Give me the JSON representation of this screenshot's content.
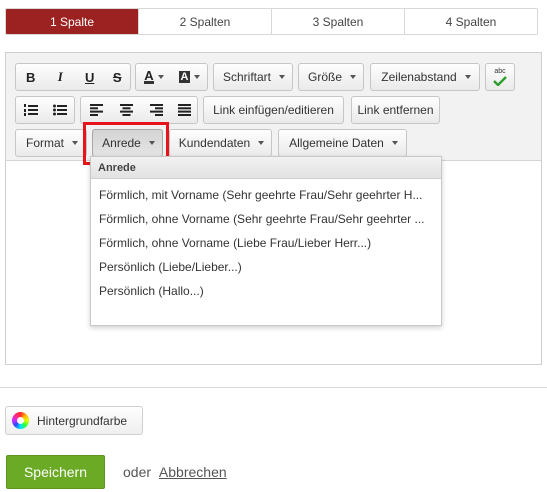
{
  "column_tabs": [
    "1 Spalte",
    "2 Spalten",
    "3 Spalten",
    "4 Spalten"
  ],
  "toolbar": {
    "bold": "B",
    "italic": "I",
    "underline": "U",
    "strike": "S",
    "font_color": "A",
    "bg_color": "A",
    "font_label": "Schriftart",
    "size_label": "Größe",
    "line_height_label": "Zeilenabstand",
    "spellcheck_label": "abc",
    "link_insert_label": "Link einfügen/editieren",
    "link_remove_label": "Link entfernen",
    "format_label": "Format",
    "salutation_label": "Anrede",
    "customer_data_label": "Kundendaten",
    "general_data_label": "Allgemeine Daten"
  },
  "menu": {
    "header": "Anrede",
    "items": [
      "Förmlich, mit Vorname (Sehr geehrte Frau/Sehr geehrter H...",
      "Förmlich, ohne Vorname (Sehr geehrte Frau/Sehr geehrter ...",
      "Förmlich, ohne Vorname (Liebe Frau/Lieber Herr...)",
      "Persönlich (Liebe/Lieber...)",
      "Persönlich (Hallo...)"
    ]
  },
  "background_button": "Hintergrundfarbe",
  "actions": {
    "save": "Speichern",
    "or": "oder",
    "cancel": "Abbrechen"
  },
  "colors": {
    "active_tab": "#9c2222",
    "save": "#6aaa24",
    "highlight": "#e8141b"
  }
}
